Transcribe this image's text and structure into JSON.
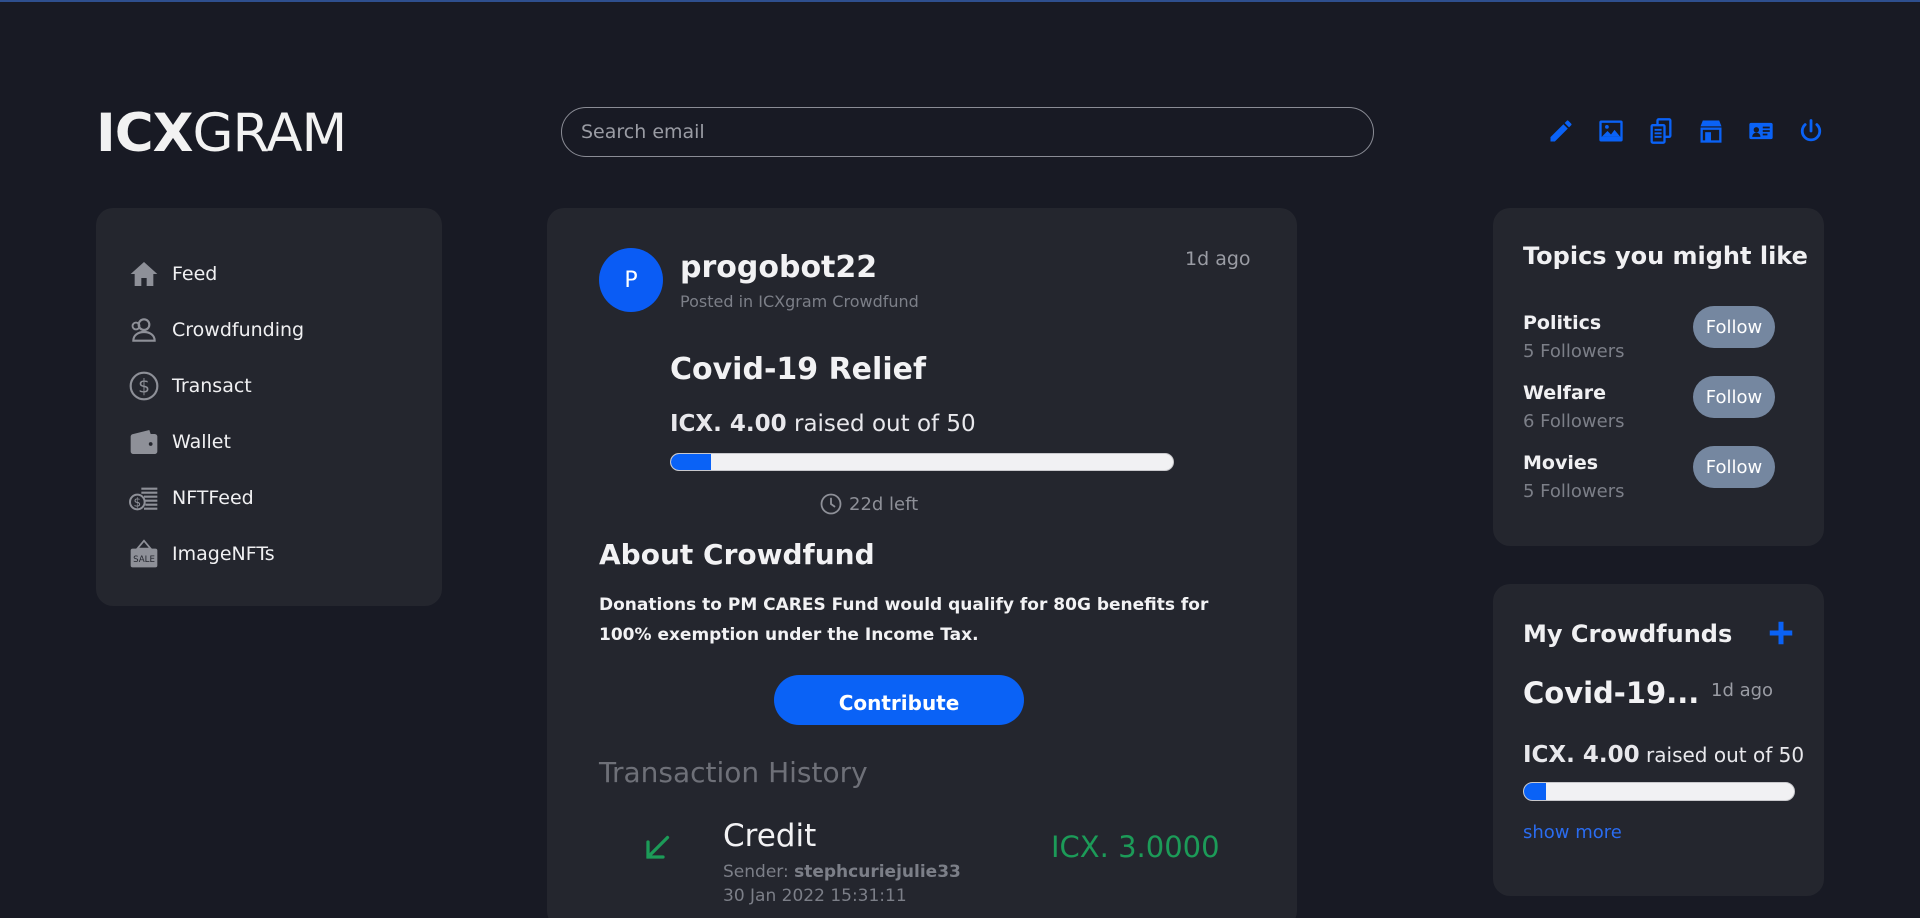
{
  "app": {
    "logo_bold": "ICX",
    "logo_light": "GRAM"
  },
  "search": {
    "placeholder": "Search email",
    "value": ""
  },
  "top_icons": [
    "pencil-icon",
    "image-icon",
    "documents-icon",
    "shop-icon",
    "id-card-icon",
    "power-icon"
  ],
  "colors": {
    "background": "#181a24",
    "panel": "#24262e",
    "accent": "#0a62f6",
    "credit_green": "#1c9b58",
    "follow_button": "#7587a0"
  },
  "sidebar": {
    "items": [
      {
        "label": "Feed",
        "icon": "home-icon"
      },
      {
        "label": "Crowdfunding",
        "icon": "people-icon"
      },
      {
        "label": "Transact",
        "icon": "dollar-circle-icon"
      },
      {
        "label": "Wallet",
        "icon": "wallet-icon"
      },
      {
        "label": "NFTFeed",
        "icon": "coins-stack-icon"
      },
      {
        "label": "ImageNFTs",
        "icon": "sale-sign-icon"
      }
    ]
  },
  "post": {
    "avatar_letter": "P",
    "username": "progobot22",
    "posted_in": "Posted in ICXgram Crowdfund",
    "time": "1d ago",
    "crowdfund_title": "Covid-19 Relief",
    "raised_amount": "ICX. 4.00",
    "raised_suffix": " raised out of 50",
    "progress_fraction": 0.08,
    "time_left": "22d left",
    "about_title": "About Crowdfund",
    "about_text": "Donations to PM CARES Fund would qualify for 80G benefits for 100% exemption under the Income Tax.",
    "contribute_label": "Contribute"
  },
  "transactions": {
    "title": "Transaction History",
    "items": [
      {
        "type": "Credit",
        "sender_label": "Sender: ",
        "sender": "stephcuriejulie33",
        "date": "30 Jan 2022 15:31:11",
        "amount": "ICX. 3.0000"
      }
    ]
  },
  "topics": {
    "title": "Topics you might like",
    "items": [
      {
        "name": "Politics",
        "followers": "5 Followers",
        "button": "Follow"
      },
      {
        "name": "Welfare",
        "followers": "6 Followers",
        "button": "Follow"
      },
      {
        "name": "Movies",
        "followers": "5 Followers",
        "button": "Follow"
      }
    ]
  },
  "my_crowdfunds": {
    "title": "My Crowdfunds",
    "name": "Covid-19...",
    "time": "1d ago",
    "raised_amount": "ICX. 4.00",
    "raised_suffix": " raised out of 50",
    "progress_fraction": 0.08,
    "show_more": "show more"
  }
}
